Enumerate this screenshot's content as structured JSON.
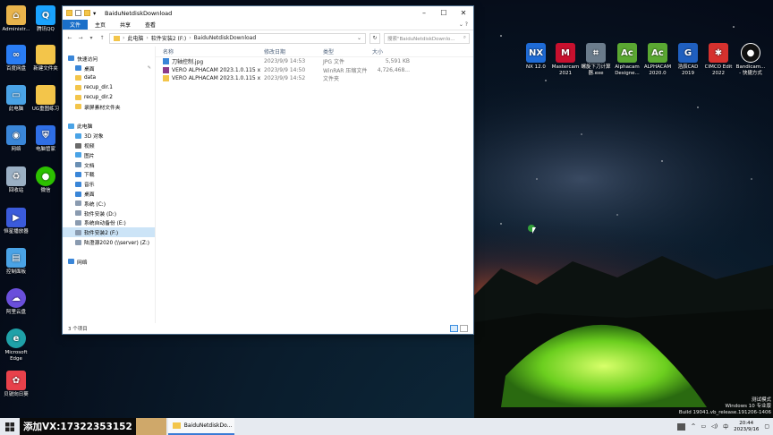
{
  "desktop": {
    "left_icons": [
      {
        "label": "Administr...",
        "icon": "user-folder-icon",
        "color": "#e9b44c"
      },
      {
        "label": "腾讯QQ",
        "icon": "qq-icon",
        "color": "#1aa3ff"
      },
      {
        "label": "百度网盘",
        "icon": "baidu-netdisk-icon",
        "color": "#2a7df4"
      },
      {
        "label": "新建文件夹",
        "icon": "folder-icon",
        "color": "#f3c54a"
      },
      {
        "label": "此电脑",
        "icon": "computer-icon",
        "color": "#4aa3e6"
      },
      {
        "label": "UG重图练习",
        "icon": "folder-icon",
        "color": "#f3c54a"
      },
      {
        "label": "网络",
        "icon": "network-icon",
        "color": "#3a86d8"
      },
      {
        "label": "电脑管家",
        "icon": "shield-icon",
        "color": "#2f6fe6"
      },
      {
        "label": "回收站",
        "icon": "recycle-bin-icon",
        "color": "#9bb0c4"
      },
      {
        "label": "微信",
        "icon": "wechat-icon",
        "color": "#2dc100"
      },
      {
        "label": "恒星播放器",
        "icon": "player-icon",
        "color": "#3b5bdb"
      },
      {
        "label": "控制面板",
        "icon": "control-panel-icon",
        "color": "#4aa3e6"
      },
      {
        "label": "阿里云盘",
        "icon": "cloud-drive-icon",
        "color": "#6a4fdb"
      },
      {
        "label": "Microsoft Edge",
        "icon": "edge-icon",
        "color": "#1fa1a8"
      },
      {
        "label": "贝锐向日葵",
        "icon": "sunflower-icon",
        "color": "#e8414b"
      }
    ],
    "right_icons": [
      {
        "label": "NX 12.0",
        "icon": "nx-icon",
        "color": "#1e6bd6"
      },
      {
        "label": "Mastercam 2021",
        "icon": "mastercam-icon",
        "color": "#c8102e"
      },
      {
        "label": "螺旋下刀计算器.exe",
        "icon": "calculator-icon",
        "color": "#6b7c8c"
      },
      {
        "label": "Alphacam Designe...",
        "icon": "alphacam-designer-icon",
        "color": "#5aa832"
      },
      {
        "label": "ALPHACAM 2020.0",
        "icon": "alphacam-icon",
        "color": "#5aa832"
      },
      {
        "label": "浩辰CAD 2019",
        "icon": "gstarcad-icon",
        "color": "#1f5fbf"
      },
      {
        "label": "CIMCO Edit 2022",
        "icon": "cimco-icon",
        "color": "#d6312e"
      },
      {
        "label": "Bandicam... - 快捷方式",
        "icon": "bandicam-icon",
        "color": "#111111"
      }
    ]
  },
  "window": {
    "title": "BaiduNetdiskDownload",
    "ribbon_tabs": [
      "文件",
      "主页",
      "共享",
      "查看"
    ],
    "address": {
      "parts": [
        "此电脑",
        "软件安装2 (F:)",
        "BaiduNetdiskDownload"
      ]
    },
    "search": {
      "placeholder": "搜索\"BaiduNetdiskDownlo..."
    },
    "nav_items": [
      {
        "label": "快速访问",
        "icon": "star-icon",
        "color": "#3a86d8",
        "indent": 1,
        "pinned": false,
        "selected": false
      },
      {
        "label": "桌面",
        "icon": "desktop-icon",
        "color": "#3a86d8",
        "indent": 2,
        "pinned": true,
        "selected": false
      },
      {
        "label": "data",
        "icon": "folder-icon",
        "color": "#f3c54a",
        "indent": 2,
        "pinned": false,
        "selected": false
      },
      {
        "label": "recup_dir.1",
        "icon": "folder-icon",
        "color": "#f3c54a",
        "indent": 2,
        "pinned": false,
        "selected": false
      },
      {
        "label": "recup_dir.2",
        "icon": "folder-icon",
        "color": "#f3c54a",
        "indent": 2,
        "pinned": false,
        "selected": false
      },
      {
        "label": "录屏素材文件夹",
        "icon": "folder-icon",
        "color": "#f3c54a",
        "indent": 2,
        "pinned": false,
        "selected": false
      },
      {
        "label": "",
        "icon": "",
        "color": "",
        "indent": 0,
        "pinned": false,
        "selected": false
      },
      {
        "label": "此电脑",
        "icon": "computer-icon",
        "color": "#4aa3e6",
        "indent": 1,
        "pinned": false,
        "selected": false
      },
      {
        "label": "3D 对象",
        "icon": "cube-icon",
        "color": "#4aa3e6",
        "indent": 2,
        "pinned": false,
        "selected": false
      },
      {
        "label": "视频",
        "icon": "video-icon",
        "color": "#6a6a6a",
        "indent": 2,
        "pinned": false,
        "selected": false
      },
      {
        "label": "图片",
        "icon": "picture-icon",
        "color": "#4aa3e6",
        "indent": 2,
        "pinned": false,
        "selected": false
      },
      {
        "label": "文档",
        "icon": "document-icon",
        "color": "#6a8fb3",
        "indent": 2,
        "pinned": false,
        "selected": false
      },
      {
        "label": "下载",
        "icon": "download-icon",
        "color": "#3a86d8",
        "indent": 2,
        "pinned": false,
        "selected": false
      },
      {
        "label": "音乐",
        "icon": "music-icon",
        "color": "#3a86d8",
        "indent": 2,
        "pinned": false,
        "selected": false
      },
      {
        "label": "桌面",
        "icon": "desktop-icon",
        "color": "#3a86d8",
        "indent": 2,
        "pinned": false,
        "selected": false
      },
      {
        "label": "系统 (C:)",
        "icon": "drive-icon",
        "color": "#8a9bb0",
        "indent": 2,
        "pinned": false,
        "selected": false
      },
      {
        "label": "软件安装 (D:)",
        "icon": "drive-icon",
        "color": "#8a9bb0",
        "indent": 2,
        "pinned": false,
        "selected": false
      },
      {
        "label": "系统自动备份 (E:)",
        "icon": "drive-icon",
        "color": "#8a9bb0",
        "indent": 2,
        "pinned": false,
        "selected": false
      },
      {
        "label": "软件安装2 (F:)",
        "icon": "drive-icon",
        "color": "#8a9bb0",
        "indent": 2,
        "pinned": false,
        "selected": true
      },
      {
        "label": "陆澄源2020 (\\\\server) (Z:)",
        "icon": "network-drive-icon",
        "color": "#8a9bb0",
        "indent": 2,
        "pinned": false,
        "selected": false
      },
      {
        "label": "",
        "icon": "",
        "color": "",
        "indent": 0,
        "pinned": false,
        "selected": false
      },
      {
        "label": "网络",
        "icon": "network-icon",
        "color": "#3a86d8",
        "indent": 1,
        "pinned": false,
        "selected": false
      }
    ],
    "columns": [
      "名称",
      "修改日期",
      "类型",
      "大小"
    ],
    "files": [
      {
        "name": "刀轴控制.jpg",
        "date": "2023/9/9 14:53",
        "type": "JPG 文件",
        "size": "5,591 KB",
        "icon": "image-file-icon",
        "color": "#3a86d8"
      },
      {
        "name": "VERO ALPHACAM 2023.1.0.115 x64 ...",
        "date": "2023/9/9 14:50",
        "type": "WinRAR 压缩文件",
        "size": "4,726,468...",
        "icon": "winrar-icon",
        "color": "#8b3a8b"
      },
      {
        "name": "VERO ALPHACAM 2023.1.0.115 x64 ...",
        "date": "2023/9/9 14:52",
        "type": "文件夹",
        "size": "",
        "icon": "folder-icon",
        "color": "#f3c54a"
      }
    ],
    "status": "3 个项目"
  },
  "taskbar": {
    "banner": "添加VX:17322353152",
    "active_app": "BaiduNetdiskDo...",
    "time": "20:44",
    "date": "2023/9/16"
  },
  "watermark": {
    "line1": "测试模式",
    "line2": "Windows 10 专业版",
    "line3": "Build 19041.vb_release.191206-1406"
  }
}
